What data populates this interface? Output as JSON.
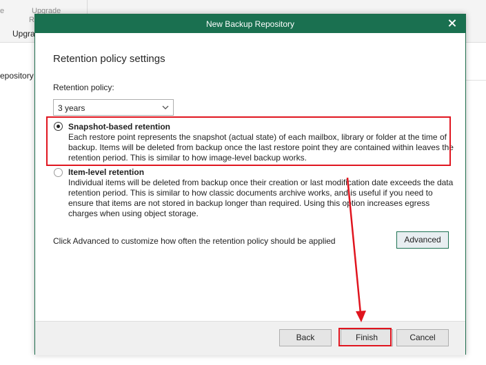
{
  "background": {
    "ribbon_left_fragment": "e",
    "ribbon_upgrade_top": "Upgrade",
    "ribbon_upgrade_bottom": "R",
    "ribbon_group_label": "Upgra",
    "sidebar_item": "epository"
  },
  "dialog": {
    "title": "New Backup Repository",
    "heading": "Retention policy settings",
    "retention_label": "Retention policy:",
    "retention_value": "3 years",
    "options": [
      {
        "title": "Snapshot-based retention",
        "description": "Each restore point represents the snapshot (actual state) of each mailbox, library or folder at the time of backup. Items will be deleted from backup once the last restore point they are contained within leaves the retention period. This is similar to how image-level backup works.",
        "selected": true
      },
      {
        "title": "Item-level retention",
        "description": "Individual items will be deleted from backup once their creation or last modification date exceeds the data retention period. This is similar to how classic documents archive works, and is useful if you need to ensure that items are not stored in backup longer than required. Using this option increases egress charges when using object storage.",
        "selected": false
      }
    ],
    "advanced_hint": "Click Advanced to customize how often the retention policy should be applied",
    "advanced_label": "Advanced",
    "back_label": "Back",
    "finish_label": "Finish",
    "cancel_label": "Cancel"
  },
  "icons": {
    "close": "close-icon",
    "dropdown": "chevron-down-icon",
    "annotation": "arrow-icon"
  },
  "colors": {
    "titlebar": "#1a7050",
    "annotation": "#e0141e"
  }
}
